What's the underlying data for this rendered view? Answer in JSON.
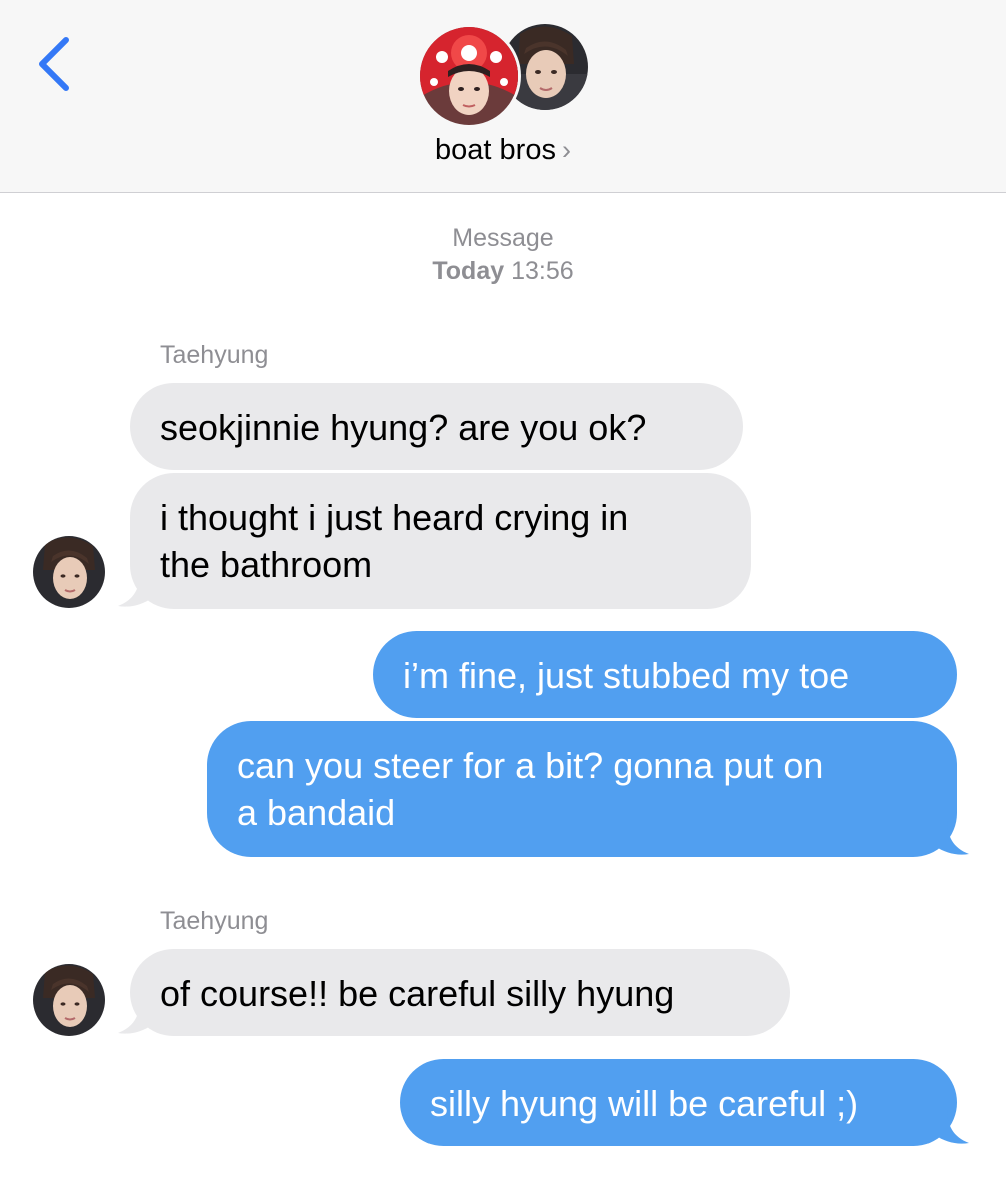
{
  "header": {
    "group_name": "boat bros",
    "chevron": "›",
    "back_icon": "chevron-left-icon",
    "accent_color": "#3478f6"
  },
  "conversation": {
    "meta_label": "Message",
    "meta_day": "Today",
    "meta_time": "13:56"
  },
  "messages": [
    {
      "sender": "Taehyung",
      "direction": "incoming",
      "text": "seokjinnie hyung? are you ok?"
    },
    {
      "direction": "incoming",
      "lines": [
        "i thought i just heard crying in",
        "the bathroom"
      ]
    },
    {
      "direction": "outgoing",
      "text": "i’m fine, just stubbed my toe"
    },
    {
      "direction": "outgoing",
      "lines": [
        "can you steer for a bit? gonna put on",
        "a bandaid"
      ]
    },
    {
      "sender": "Taehyung",
      "direction": "incoming",
      "text": "of course!! be careful silly hyung"
    },
    {
      "direction": "outgoing",
      "text": "silly hyung will be careful ;)"
    }
  ],
  "colors": {
    "incoming_bubble": "#e9e9eb",
    "outgoing_bubble": "#519ff0",
    "meta_text": "#8e8e93"
  }
}
